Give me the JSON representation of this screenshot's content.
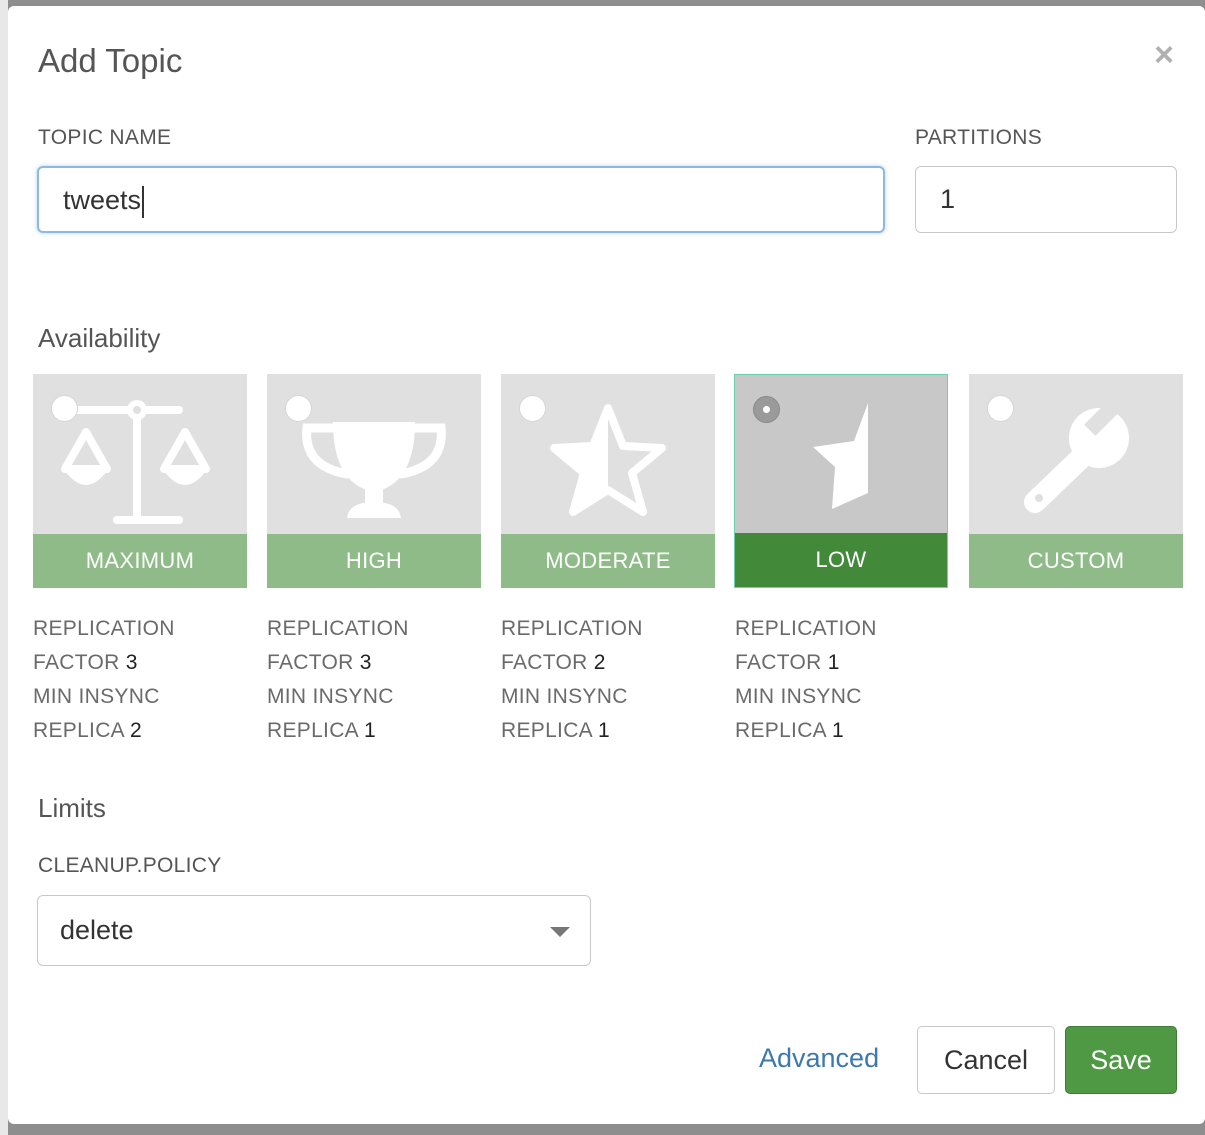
{
  "modal": {
    "title": "Add Topic",
    "close_glyph": "×"
  },
  "topic_name": {
    "label": "TOPIC NAME",
    "value": "tweets"
  },
  "partitions": {
    "label": "PARTITIONS",
    "value": "1"
  },
  "availability": {
    "heading": "Availability",
    "selected": "LOW",
    "options": [
      {
        "label": "MAXIMUM",
        "icon": "scale-icon",
        "spec_line1": "REPLICATION",
        "factor_label": "FACTOR",
        "factor": "3",
        "line3": "MIN INSYNC",
        "replica_label": "REPLICA",
        "replica": "2"
      },
      {
        "label": "HIGH",
        "icon": "trophy-icon",
        "spec_line1": "REPLICATION",
        "factor_label": "FACTOR",
        "factor": "3",
        "line3": "MIN INSYNC",
        "replica_label": "REPLICA",
        "replica": "1"
      },
      {
        "label": "MODERATE",
        "icon": "half-star-icon",
        "spec_line1": "REPLICATION",
        "factor_label": "FACTOR",
        "factor": "2",
        "line3": "MIN INSYNC",
        "replica_label": "REPLICA",
        "replica": "1"
      },
      {
        "label": "LOW",
        "icon": "star-shard-icon",
        "spec_line1": "REPLICATION",
        "factor_label": "FACTOR",
        "factor": "1",
        "line3": "MIN INSYNC",
        "replica_label": "REPLICA",
        "replica": "1"
      },
      {
        "label": "CUSTOM",
        "icon": "wrench-icon"
      }
    ]
  },
  "limits": {
    "heading": "Limits",
    "cleanup_policy": {
      "label": "CLEANUP.POLICY",
      "value": "delete"
    }
  },
  "footer": {
    "advanced_label": "Advanced",
    "cancel_label": "Cancel",
    "save_label": "Save"
  },
  "colors": {
    "band": "#8fbb88",
    "band_selected": "#428a3a",
    "save_button": "#4f9945",
    "link": "#3e78b0",
    "focus_border": "#8cb8e6"
  }
}
